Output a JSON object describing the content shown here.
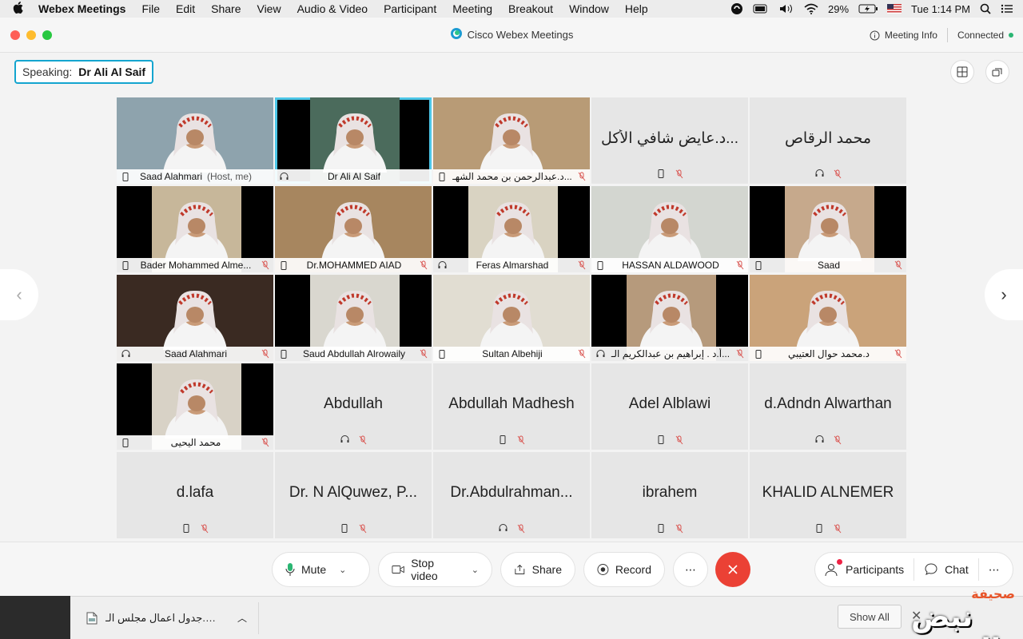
{
  "menubar": {
    "app_name": "Webex Meetings",
    "menus": [
      "File",
      "Edit",
      "Share",
      "View",
      "Audio & Video",
      "Participant",
      "Meeting",
      "Breakout",
      "Window",
      "Help"
    ],
    "battery": "29%",
    "clock": "Tue 1:14 PM"
  },
  "window": {
    "title": "Cisco Webex Meetings",
    "meeting_info": "Meeting Info",
    "status": "Connected",
    "status_color": "#2bb673"
  },
  "speaking": {
    "label": "Speaking:",
    "name": "Dr Ali Al Saif"
  },
  "tiles": [
    {
      "kind": "video",
      "name": "Saad Alahmari",
      "sub": "(Host, me)",
      "active": true,
      "bg": "#8ea3ad"
    },
    {
      "kind": "video",
      "name": "Dr Ali Al Saif",
      "active": true,
      "bg": "#4b6b5c"
    },
    {
      "kind": "video",
      "name": "د.عبدالرحمن بن محمد الشهـ...",
      "bg": "#b89b76"
    },
    {
      "kind": "text",
      "name": "د.عايض شافي الأكل..."
    },
    {
      "kind": "text",
      "name": "محمد الرقاص"
    },
    {
      "kind": "video",
      "name": "Bader Mohammed Alme...",
      "bg": "#c7b79a"
    },
    {
      "kind": "video",
      "name": "Dr.MOHAMMED AIAD",
      "bg": "#a7865f"
    },
    {
      "kind": "video",
      "name": "Feras Almarshad",
      "bg": "#d9d3c2"
    },
    {
      "kind": "video",
      "name": "HASSAN ALDAWOOD",
      "bg": "#d3d6d0"
    },
    {
      "kind": "video",
      "name": "Saad",
      "bg": "#c6a98c"
    },
    {
      "kind": "video",
      "name": "Saad Alahmari",
      "bg": "#3a2a22"
    },
    {
      "kind": "video",
      "name": "Saud Abdullah Alrowaily",
      "bg": "#d9d7cf"
    },
    {
      "kind": "video",
      "name": "Sultan Albehiji",
      "bg": "#e1ddd2"
    },
    {
      "kind": "video",
      "name": "أ.د . إبراهيم بن عبدالكريم الـ...",
      "bg": "#b69a7c"
    },
    {
      "kind": "video",
      "name": "د.محمد حوال العتيبي",
      "bg": "#caa37a"
    },
    {
      "kind": "video",
      "name": "محمد اليحيى",
      "bg": "#d8d2c6"
    },
    {
      "kind": "text",
      "name": "Abdullah"
    },
    {
      "kind": "text",
      "name": "Abdullah Madhesh"
    },
    {
      "kind": "text",
      "name": "Adel Alblawi"
    },
    {
      "kind": "text",
      "name": "d.Adndn Alwarthan"
    },
    {
      "kind": "text",
      "name": "d.lafa"
    },
    {
      "kind": "text",
      "name": "Dr. N AlQuwez, P..."
    },
    {
      "kind": "text",
      "name": "Dr.Abdulrahman..."
    },
    {
      "kind": "text",
      "name": "ibrahem"
    },
    {
      "kind": "text",
      "name": "KHALID ALNEMER"
    }
  ],
  "controls": {
    "mute": "Mute",
    "stop_video": "Stop video",
    "share": "Share",
    "record": "Record",
    "more": "⋯",
    "participants": "Participants",
    "chat": "Chat",
    "end_color": "#eb4135"
  },
  "downloads": {
    "file_name": "جدول اعمال مجلس الـ....pdf",
    "show_all": "Show All"
  },
  "watermark": {
    "top": "صحيفة",
    "main": "نبض الوشم"
  }
}
